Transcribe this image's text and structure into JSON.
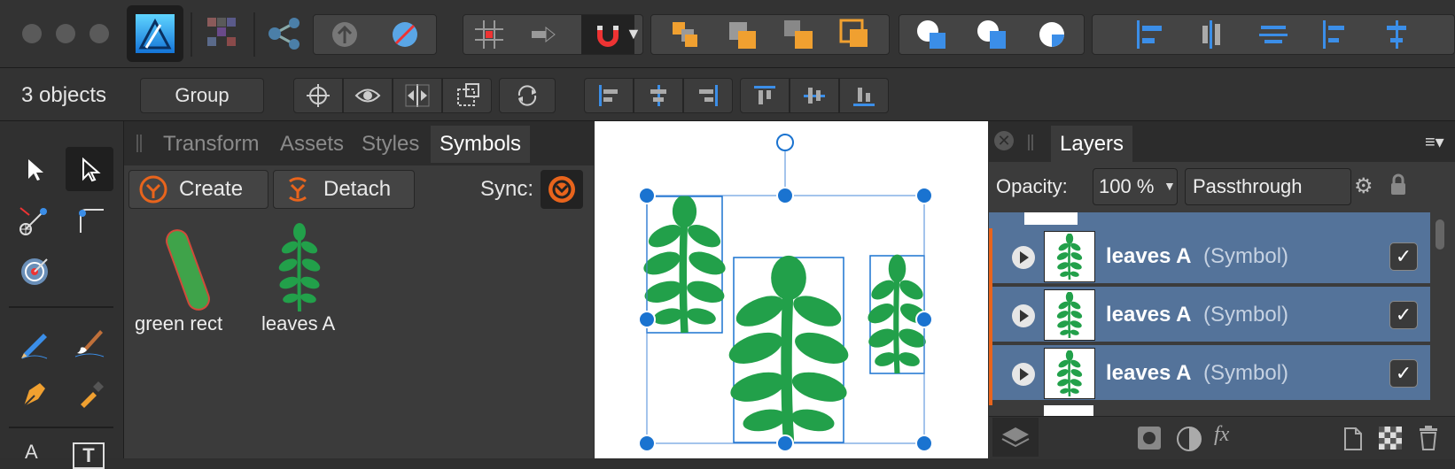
{
  "context": {
    "selection_label": "3 objects",
    "group_button": "Group"
  },
  "symbols_panel": {
    "tabs": [
      "Transform",
      "Assets",
      "Styles",
      "Symbols"
    ],
    "active_tab": "Symbols",
    "create_label": "Create",
    "detach_label": "Detach",
    "sync_label": "Sync:",
    "items": [
      {
        "label": "green rect"
      },
      {
        "label": "leaves A"
      }
    ]
  },
  "layers_panel": {
    "title": "Layers",
    "opacity_label": "Opacity:",
    "opacity_value": "100 %",
    "blend_mode": "Passthrough",
    "rows": [
      {
        "name": "leaves A",
        "type": "(Symbol)",
        "checked": true
      },
      {
        "name": "leaves A",
        "type": "(Symbol)",
        "checked": true
      },
      {
        "name": "leaves A",
        "type": "(Symbol)",
        "checked": true
      }
    ],
    "check_glyph": "✓"
  },
  "colors": {
    "accent_orange": "#e8641c",
    "leaf_green": "#22a04a",
    "selection_blue": "#1a73d0",
    "layer_selected": "#54739a"
  }
}
